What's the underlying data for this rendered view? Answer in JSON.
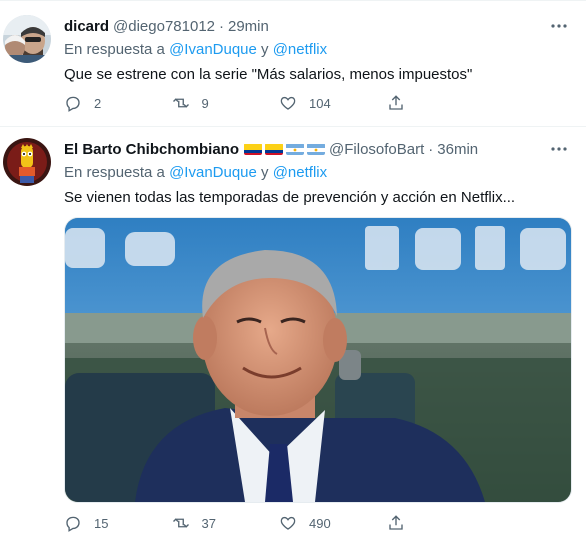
{
  "tweets": [
    {
      "name": "dicard",
      "handle": "@diego781012",
      "time": "29min",
      "reply_prefix": "En respuesta a",
      "reply_to_1": "@IvanDuque",
      "reply_join": "y",
      "reply_to_2": "@netflix",
      "text": "Que se estrene con la serie \"Más salarios, menos impuestos\"",
      "replies": "2",
      "retweets": "9",
      "likes": "104"
    },
    {
      "name": "El Barto Chibchombiano",
      "handle": "@FilosofoBart",
      "time": "36min",
      "reply_prefix": "En respuesta a",
      "reply_to_1": "@IvanDuque",
      "reply_join": "y",
      "reply_to_2": "@netflix",
      "text": "Se vienen todas las temporadas de prevención y acción en Netflix...",
      "replies": "15",
      "retweets": "37",
      "likes": "490",
      "flags": [
        "colombia",
        "colombia",
        "argentina",
        "argentina"
      ]
    }
  ],
  "dot": "·",
  "colors": {
    "accent": "#1d9bf0",
    "secondary_text": "#536471",
    "divider": "#eff3f4"
  }
}
